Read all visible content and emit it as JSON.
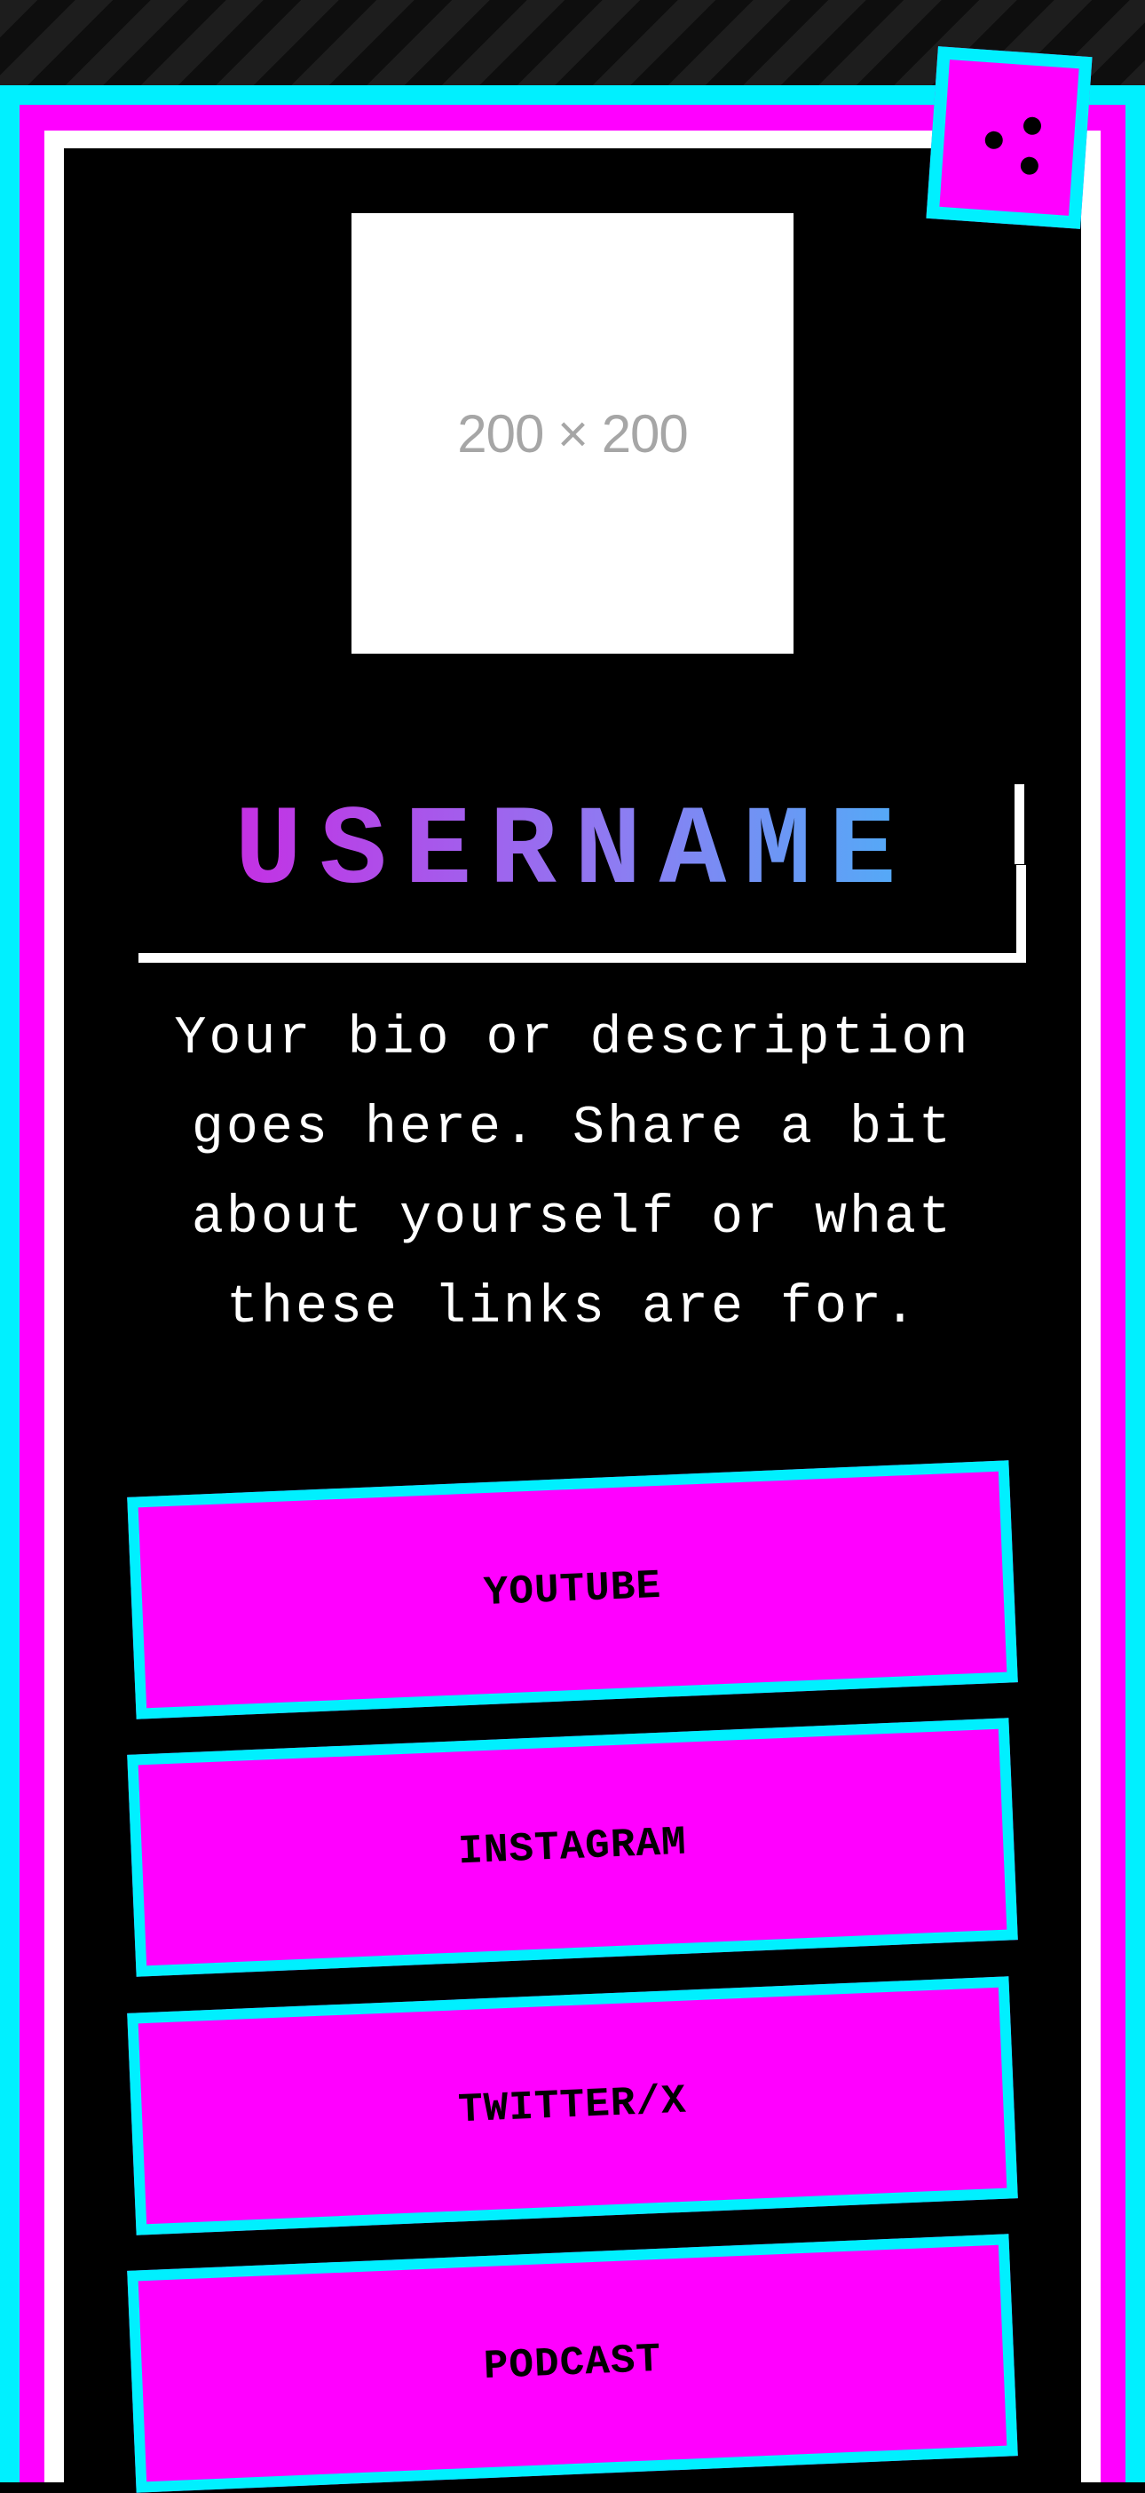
{
  "profile": {
    "avatar_placeholder": "200 × 200",
    "username": "USERNAME",
    "bio": "Your bio or description goes here. Share a bit about yourself or what these links are for."
  },
  "links": [
    {
      "label": "YOUTUBE"
    },
    {
      "label": "INSTAGRAM"
    },
    {
      "label": "TWITTER/X"
    },
    {
      "label": "PODCAST"
    }
  ],
  "theme": {
    "background": "#000000",
    "accent_cyan": "#00f0ff",
    "accent_magenta": "#ff00ff",
    "frame_white": "#ffffff",
    "username_gradient": [
      "#d21de0",
      "#3dbcf9"
    ]
  },
  "decorations": {
    "corner_badge_icon": "dice-icon"
  }
}
